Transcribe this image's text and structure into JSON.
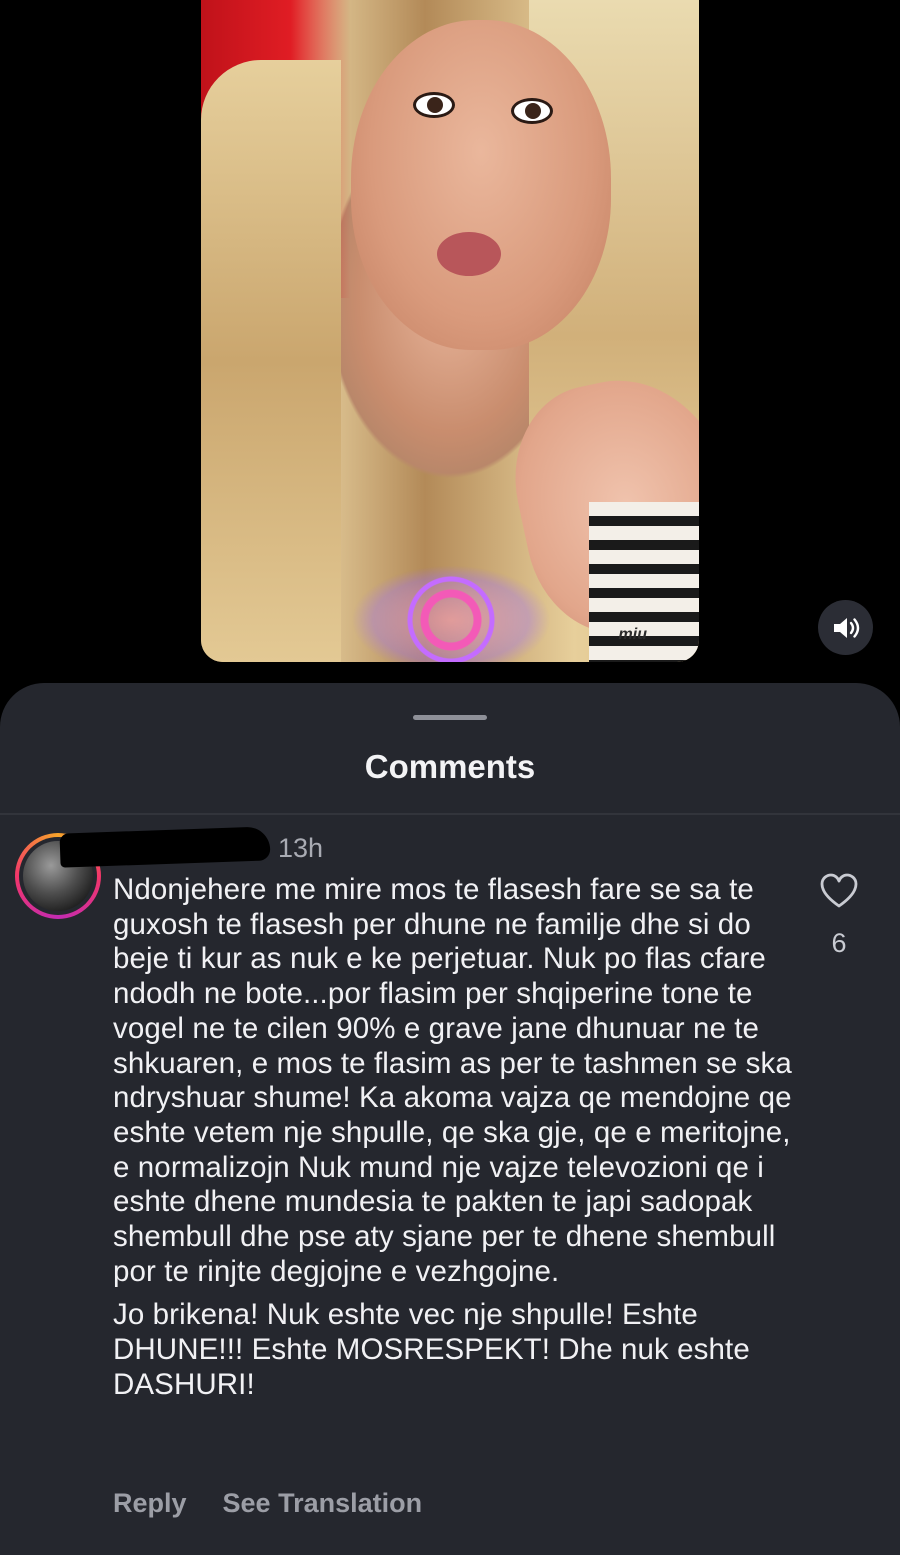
{
  "sheet": {
    "title": "Comments"
  },
  "video": {
    "overlay_logo_text": "miu",
    "volume_icon": "speaker-on-icon"
  },
  "comment": {
    "timestamp": "13h",
    "paragraphs": [
      "Ndonjehere me mire mos te flasesh fare se sa te guxosh te flasesh per dhune ne familje dhe si do beje ti kur as nuk e ke perjetuar. Nuk po flas cfare ndodh ne bote...por flasim per shqiperine tone te vogel ne te cilen 90% e grave jane dhunuar ne te shkuaren, e mos te flasim as per te tashmen se ska ndryshuar shume! Ka akoma vajza qe mendojne qe eshte vetem nje shpulle, qe ska gje, qe e meritojne, e normalizojn Nuk mund nje vajze televozioni qe i eshte dhene mundesia te pakten te japi sadopak shembull dhe pse aty sjane per te dhene shembull por te rinjte degjojne e vezhgojne.",
      "Jo brikena! Nuk eshte vec nje shpulle! Eshte DHUNE!!! Eshte MOSRESPEKT! Dhe nuk eshte DASHURI!"
    ],
    "like_count": "6",
    "reply_label": "Reply",
    "translation_label": "See Translation"
  },
  "colors": {
    "sheet_bg": "#25272e",
    "text_primary": "#f1f1f4",
    "text_secondary": "#a9abb3"
  }
}
